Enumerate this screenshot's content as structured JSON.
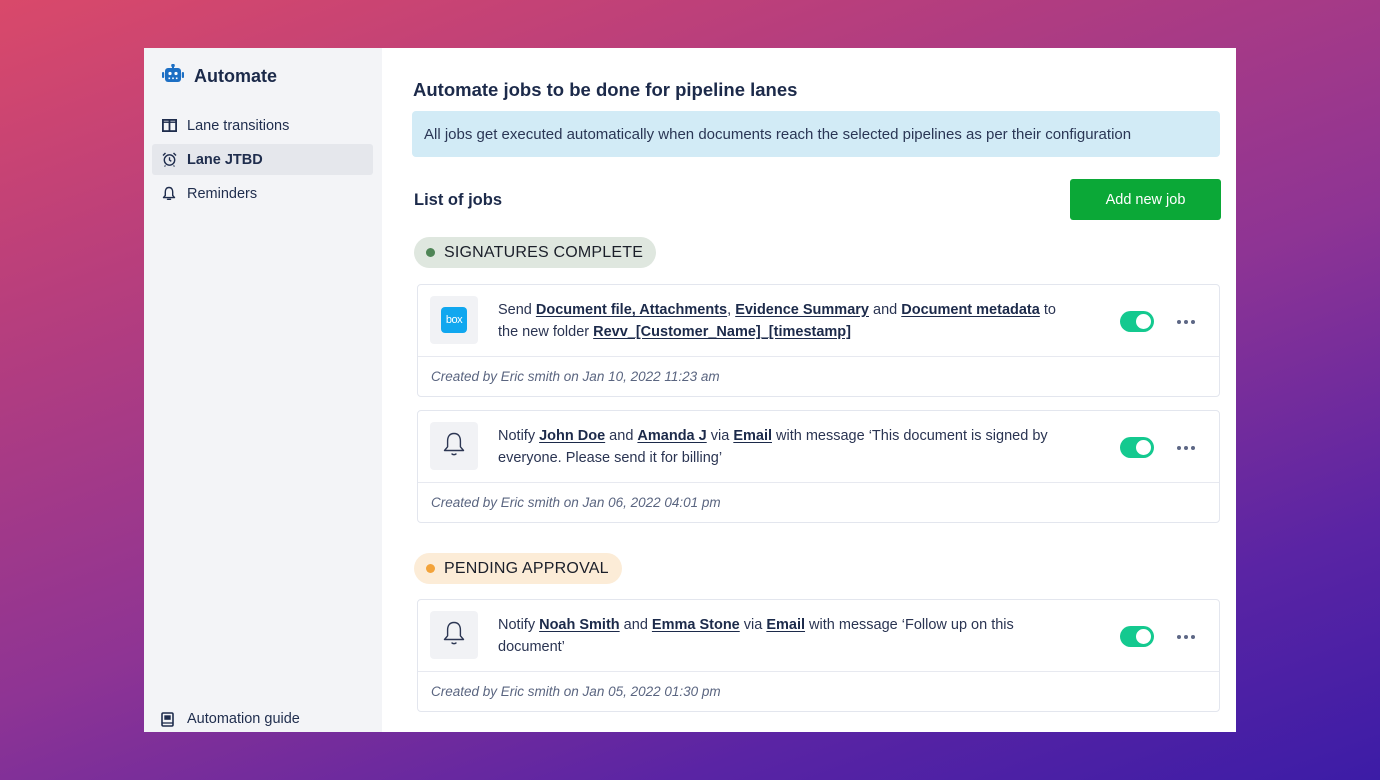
{
  "sidebar": {
    "brand": {
      "icon": "robot-icon",
      "title": "Automate",
      "color": "#1d6fc4"
    },
    "items": [
      {
        "icon": "columns-icon",
        "label": "Lane transitions",
        "active": false
      },
      {
        "icon": "alarm-clock-icon",
        "label": "Lane JTBD",
        "active": true
      },
      {
        "icon": "bell-icon",
        "label": "Reminders",
        "active": false
      }
    ],
    "footer": {
      "icon": "book-icon",
      "label": "Automation guide"
    }
  },
  "main": {
    "title": "Automate jobs to be done for pipeline lanes",
    "info_banner": "All jobs get executed automatically when documents reach the selected pipelines as per their configuration",
    "list_title": "List of jobs",
    "add_button": "Add new job",
    "groups": [
      {
        "label": "SIGNATURES COMPLETE",
        "color": "#4f8556",
        "jobs": [
          {
            "icon": "box-logo",
            "icon_text": "box",
            "parts": {
              "t1": "Send ",
              "l1": "Document file, Attachments",
              "t2": ", ",
              "l2": "Evidence Summary",
              "t3": " and ",
              "l3": "Document metadata",
              "t4": " to the new folder ",
              "l4": "Revv_[Customer_Name]_[timestamp]"
            },
            "enabled": true,
            "created": "Created by Eric smith on Jan 10, 2022 11:23 am"
          },
          {
            "icon": "bell-icon",
            "parts": {
              "t1": "Notify ",
              "l1": "John Doe",
              "t2": " and ",
              "l2": "Amanda J",
              "t3": " via ",
              "l3": "Email",
              "t4": " with message ‘This document is signed by everyone. Please send it for billing’"
            },
            "enabled": true,
            "created": "Created by Eric smith on Jan 06, 2022 04:01 pm"
          }
        ]
      },
      {
        "label": "PENDING APPROVAL",
        "color": "#f3a33a",
        "jobs": [
          {
            "icon": "bell-icon",
            "parts": {
              "t1": "Notify ",
              "l1": "Noah Smith",
              "t2": " and ",
              "l2": "Emma Stone",
              "t3": " via ",
              "l3": "Email",
              "t4": " with message ‘Follow up on this document’"
            },
            "enabled": true,
            "created": "Created by Eric smith on Jan 05, 2022 01:30 pm"
          }
        ]
      }
    ]
  },
  "colors": {
    "accent_green": "#0ba837",
    "toggle_on": "#14c98f",
    "info_bg": "#d2ebf6"
  }
}
